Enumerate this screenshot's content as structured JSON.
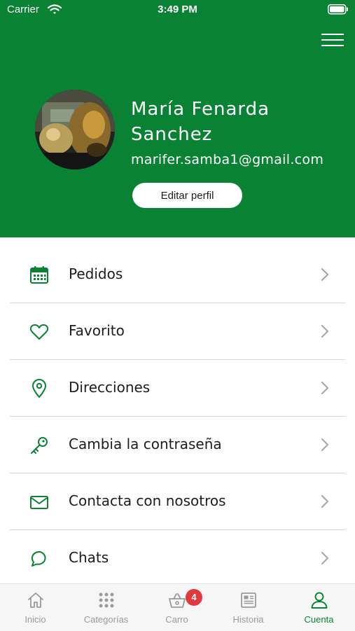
{
  "status_bar": {
    "carrier": "Carrier",
    "time": "3:49 PM"
  },
  "profile": {
    "name": "María Fenarda Sanchez",
    "email": "marifer.samba1@gmail.com",
    "edit_label": "Editar perfil"
  },
  "colors": {
    "brand": "#0a8233",
    "badge": "#e03a3e"
  },
  "menu": [
    {
      "label": "Pedidos",
      "icon": "calendar-icon"
    },
    {
      "label": "Favorito",
      "icon": "heart-icon"
    },
    {
      "label": "Direcciones",
      "icon": "location-pin-icon"
    },
    {
      "label": "Cambia la contraseña",
      "icon": "key-icon"
    },
    {
      "label": "Contacta con nosotros",
      "icon": "mail-icon"
    },
    {
      "label": "Chats",
      "icon": "chat-bubble-icon"
    }
  ],
  "tabbar": {
    "tabs": [
      {
        "label": "Inicio",
        "icon": "home-icon"
      },
      {
        "label": "Categorías",
        "icon": "grid-icon"
      },
      {
        "label": "Carro",
        "icon": "basket-icon",
        "badge": "4"
      },
      {
        "label": "Historia",
        "icon": "newspaper-icon"
      },
      {
        "label": "Cuenta",
        "icon": "user-icon",
        "active": true
      }
    ]
  }
}
